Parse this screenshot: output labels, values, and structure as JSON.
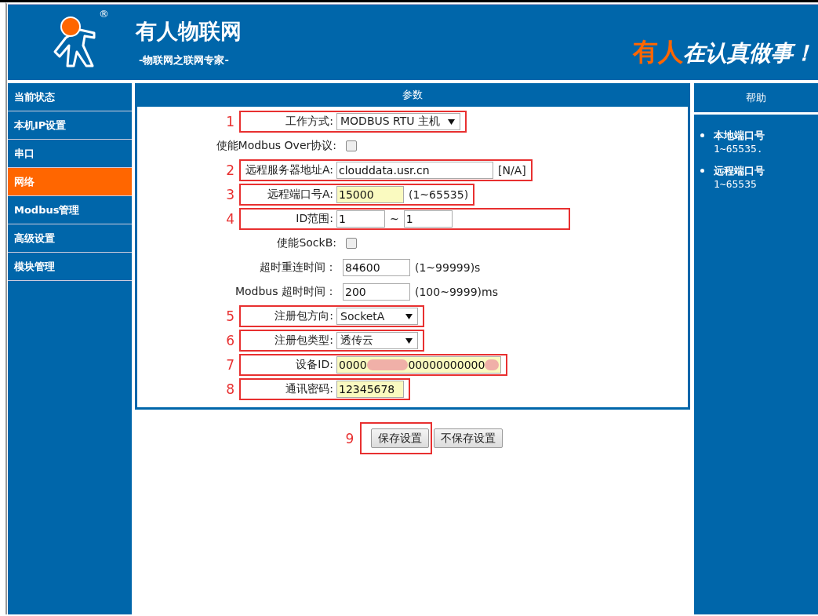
{
  "header": {
    "brand": "有人物联网",
    "registered_mark": "®",
    "tagline": "-物联网之联网专家-",
    "slogan_accent": "有人",
    "slogan_rest": "在认真做事！"
  },
  "sidebar": {
    "items": [
      {
        "label": "当前状态",
        "selected": false
      },
      {
        "label": "本机IP设置",
        "selected": false
      },
      {
        "label": "串口",
        "selected": false
      },
      {
        "label": "网络",
        "selected": true
      },
      {
        "label": "Modbus管理",
        "selected": false
      },
      {
        "label": "高级设置",
        "selected": false
      },
      {
        "label": "模块管理",
        "selected": false
      }
    ]
  },
  "panel": {
    "title": "参数",
    "rows": [
      {
        "kind": "select",
        "callout": "1",
        "label": "工作方式:",
        "value": "MODBUS  RTU  主机"
      },
      {
        "kind": "checkbox",
        "label": "使能Modbus Over协议:",
        "checked": false
      },
      {
        "kind": "text",
        "callout": "2",
        "label": "远程服务器地址A:",
        "value": "clouddata.usr.cn",
        "autofill": false,
        "hint": "[N/A]"
      },
      {
        "kind": "text",
        "callout": "3",
        "label": "远程端口号A:",
        "value": "15000",
        "autofill": true,
        "hint": "(1~65535)"
      },
      {
        "kind": "range",
        "callout": "4",
        "label": "ID范围:",
        "from": "1",
        "separator": "~",
        "to": "1"
      },
      {
        "kind": "checkbox",
        "label": "使能SockB:",
        "checked": false
      },
      {
        "kind": "text",
        "label": "超时重连时间：",
        "value": "84600",
        "autofill": false,
        "hint": "(1~99999)s"
      },
      {
        "kind": "text",
        "label": "Modbus 超时时间：",
        "value": "200",
        "autofill": false,
        "hint": "(100~9999)ms"
      },
      {
        "kind": "select",
        "callout": "5",
        "label": "注册包方向:",
        "value": "SocketA"
      },
      {
        "kind": "select",
        "callout": "6",
        "label": "注册包类型:",
        "value": "透传云"
      },
      {
        "kind": "redacted",
        "callout": "7",
        "label": "设备ID:",
        "value_parts": [
          "0000",
          "00000000000"
        ],
        "autofill": true
      },
      {
        "kind": "text",
        "callout": "8",
        "label": "通讯密码:",
        "value": "12345678",
        "autofill": true
      }
    ],
    "buttons": [
      {
        "label": "保存设置",
        "callout": "9"
      },
      {
        "label": "不保存设置"
      }
    ]
  },
  "help": {
    "title": "帮助",
    "items": [
      {
        "title": "本地端口号",
        "value": "1~65535."
      },
      {
        "title": "远程端口号",
        "value": "1~65535"
      }
    ]
  }
}
